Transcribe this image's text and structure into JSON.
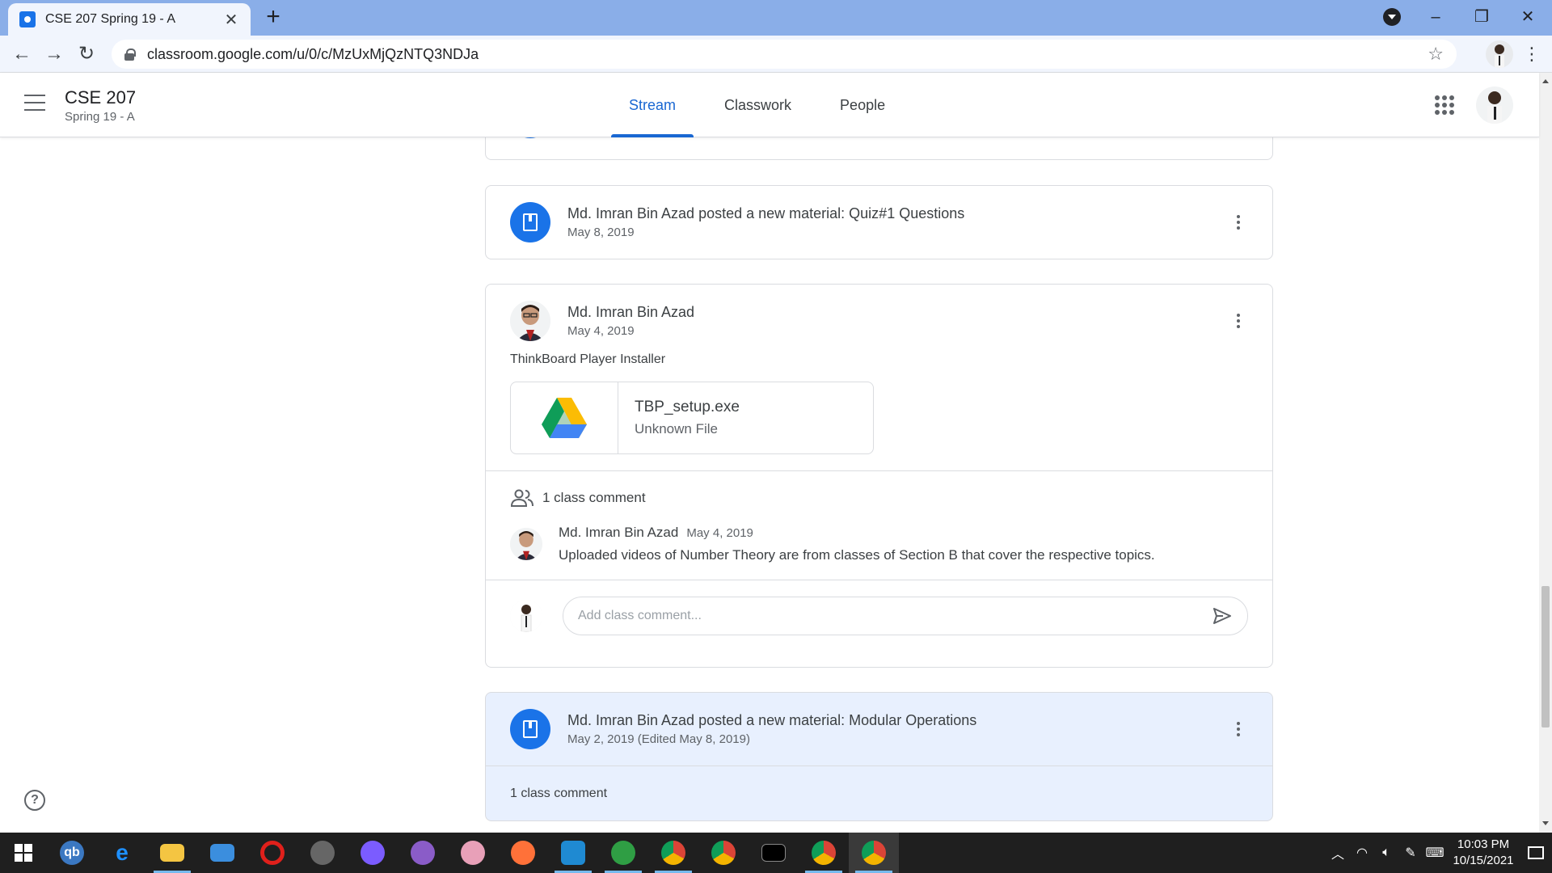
{
  "browser": {
    "tab_title": "CSE 207 Spring 19 - A",
    "url": "classroom.google.com/u/0/c/MzUxMjQzNTQ3NDJa"
  },
  "header": {
    "class_name": "CSE 207",
    "section": "Spring 19 - A",
    "tabs": [
      {
        "label": "Stream",
        "active": true
      },
      {
        "label": "Classwork",
        "active": false
      },
      {
        "label": "People",
        "active": false
      }
    ]
  },
  "stream": {
    "material1": {
      "title": "Md. Imran Bin Azad posted a new material: Quiz#1 Questions",
      "date": "May 8, 2019"
    },
    "post": {
      "author": "Md. Imran Bin Azad",
      "date": "May 4, 2019",
      "body": "ThinkBoard Player Installer",
      "attachment": {
        "name": "TBP_setup.exe",
        "type": "Unknown File"
      },
      "comments_label": "1 class comment",
      "comment": {
        "author": "Md. Imran Bin Azad",
        "date": "May 4, 2019",
        "text": "Uploaded videos of Number Theory are from classes of Section B that cover the respective topics."
      },
      "add_comment_placeholder": "Add class comment..."
    },
    "material2": {
      "title": "Md. Imran Bin Azad posted a new material: Modular Operations",
      "date": "May 2, 2019 (Edited May 8, 2019)",
      "comments_label": "1 class comment"
    }
  },
  "taskbar": {
    "time": "10:03 PM",
    "date": "10/15/2021"
  },
  "colors": {
    "accent": "#1967d2",
    "material_icon": "#1a73e8",
    "highlight_card": "#e8f0fe"
  }
}
